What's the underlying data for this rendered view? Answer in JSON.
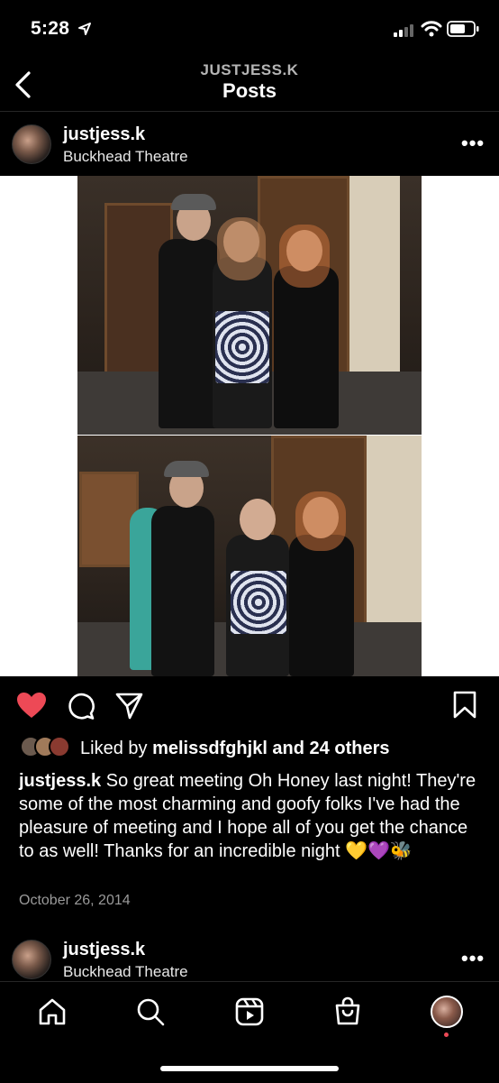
{
  "status_bar": {
    "time": "5:28"
  },
  "header": {
    "account": "JUSTJESS.K",
    "title": "Posts"
  },
  "post": {
    "username": "justjess.k",
    "location": "Buckhead Theatre",
    "likes_prefix": "Liked by ",
    "liked_by_user": "melissdfghjkl",
    "likes_suffix": " and 24 others",
    "caption_user": "justjess.k",
    "caption_text": " So great meeting Oh Honey last night! They're some of the most charming and goofy folks I've had the pleasure of meeting and I hope all of you get the chance to as well! Thanks for an incredible night ",
    "caption_emojis": "💛💜🐝",
    "date": "October 26, 2014",
    "liked": true
  },
  "next_post": {
    "username": "justjess.k",
    "location": "Buckhead Theatre"
  },
  "tab_bar": {
    "items": [
      "home-icon",
      "search-icon",
      "reels-icon",
      "shop-icon",
      "profile-avatar"
    ]
  },
  "colors": {
    "heart": "#ed4956",
    "background": "#000000",
    "notification_dot": "#ed4956"
  }
}
